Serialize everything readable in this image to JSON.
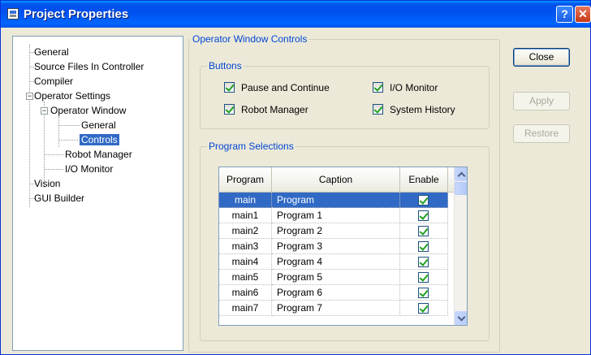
{
  "window": {
    "title": "Project Properties",
    "help_label": "?",
    "close_label": "✕"
  },
  "tree": {
    "items": [
      {
        "label": "General"
      },
      {
        "label": "Source Files In Controller"
      },
      {
        "label": "Compiler"
      },
      {
        "label": "Operator Settings",
        "expander": "−"
      },
      {
        "label": "Operator Window",
        "expander": "−"
      },
      {
        "label": "General"
      },
      {
        "label": "Controls"
      },
      {
        "label": "Robot Manager"
      },
      {
        "label": "I/O Monitor"
      },
      {
        "label": "Vision"
      },
      {
        "label": "GUI Builder"
      }
    ]
  },
  "panel": {
    "group_title": "Operator Window Controls",
    "buttons_group": {
      "title": "Buttons",
      "checkboxes": [
        {
          "label": "Pause and Continue",
          "checked": true
        },
        {
          "label": "I/O Monitor",
          "checked": true
        },
        {
          "label": "Robot Manager",
          "checked": true
        },
        {
          "label": "System History",
          "checked": true
        }
      ]
    },
    "program_group": {
      "title": "Program Selections",
      "columns": [
        "Program",
        "Caption",
        "Enable"
      ],
      "rows": [
        {
          "program": "main",
          "caption": "Program",
          "enabled": true
        },
        {
          "program": "main1",
          "caption": "Program 1",
          "enabled": true
        },
        {
          "program": "main2",
          "caption": "Program 2",
          "enabled": true
        },
        {
          "program": "main3",
          "caption": "Program 3",
          "enabled": true
        },
        {
          "program": "main4",
          "caption": "Program 4",
          "enabled": true
        },
        {
          "program": "main5",
          "caption": "Program 5",
          "enabled": true
        },
        {
          "program": "main6",
          "caption": "Program 6",
          "enabled": true
        },
        {
          "program": "main7",
          "caption": "Program 7",
          "enabled": true
        }
      ]
    }
  },
  "actions": {
    "close": "Close",
    "apply": "Apply",
    "restore": "Restore"
  }
}
